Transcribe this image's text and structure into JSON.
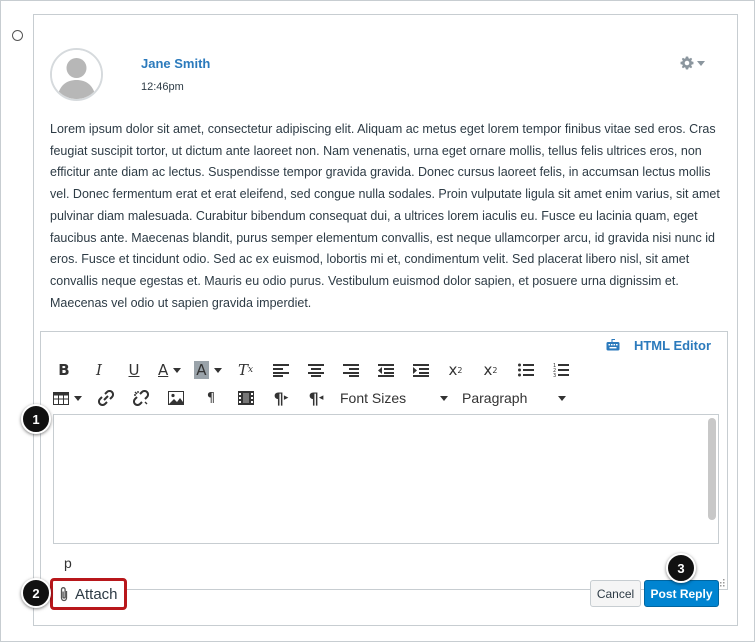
{
  "post": {
    "author": "Jane Smith",
    "time": "12:46pm",
    "body": "Lorem ipsum dolor sit amet, consectetur adipiscing elit. Aliquam ac metus eget lorem tempor finibus vitae sed eros. Cras feugiat suscipit tortor, ut dictum ante laoreet non. Nam venenatis, urna eget ornare mollis, tellus felis ultrices eros, non efficitur ante diam ac lectus. Suspendisse tempor gravida gravida. Donec cursus laoreet felis, in accumsan lectus mollis vel. Donec fermentum erat et erat eleifend, sed congue nulla sodales. Proin vulputate ligula sit amet enim varius, sit amet pulvinar diam malesuada. Curabitur bibendum consequat dui, a ultrices lorem iaculis eu. Fusce eu lacinia quam, eget faucibus ante. Maecenas blandit, purus semper elementum convallis, est neque ullamcorper arcu, id gravida nisi nunc id eros. Fusce et tincidunt odio. Sed ac ex euismod, lobortis mi et, condimentum velit. Sed placerat libero nisl, sit amet convallis neque egestas et. Mauris eu odio purus. Vestibulum euismod dolor sapien, et posuere urna dignissim et. Maecenas vel odio ut sapien gravida imperdiet."
  },
  "editor": {
    "html_editor_label": "HTML Editor",
    "font_sizes_label": "Font Sizes",
    "paragraph_label": "Paragraph",
    "path_label": "p",
    "toolbar_icons": [
      "bold-icon",
      "italic-icon",
      "underline-icon",
      "text-color-icon",
      "background-color-icon",
      "clear-formatting-icon",
      "align-left-icon",
      "align-center-icon",
      "align-right-icon",
      "outdent-icon",
      "indent-icon",
      "superscript-icon",
      "subscript-icon",
      "bulleted-list-icon",
      "numbered-list-icon",
      "table-icon",
      "link-icon",
      "unlink-icon",
      "image-icon",
      "paragraph-mark-icon",
      "media-icon",
      "ltr-icon",
      "rtl-icon"
    ]
  },
  "actions": {
    "attach_label": "Attach",
    "cancel_label": "Cancel",
    "post_reply_label": "Post Reply"
  },
  "callouts": [
    "1",
    "2",
    "3"
  ],
  "colors": {
    "link": "#2b7abc",
    "primary": "#0084d1",
    "highlight": "#b8171b"
  }
}
